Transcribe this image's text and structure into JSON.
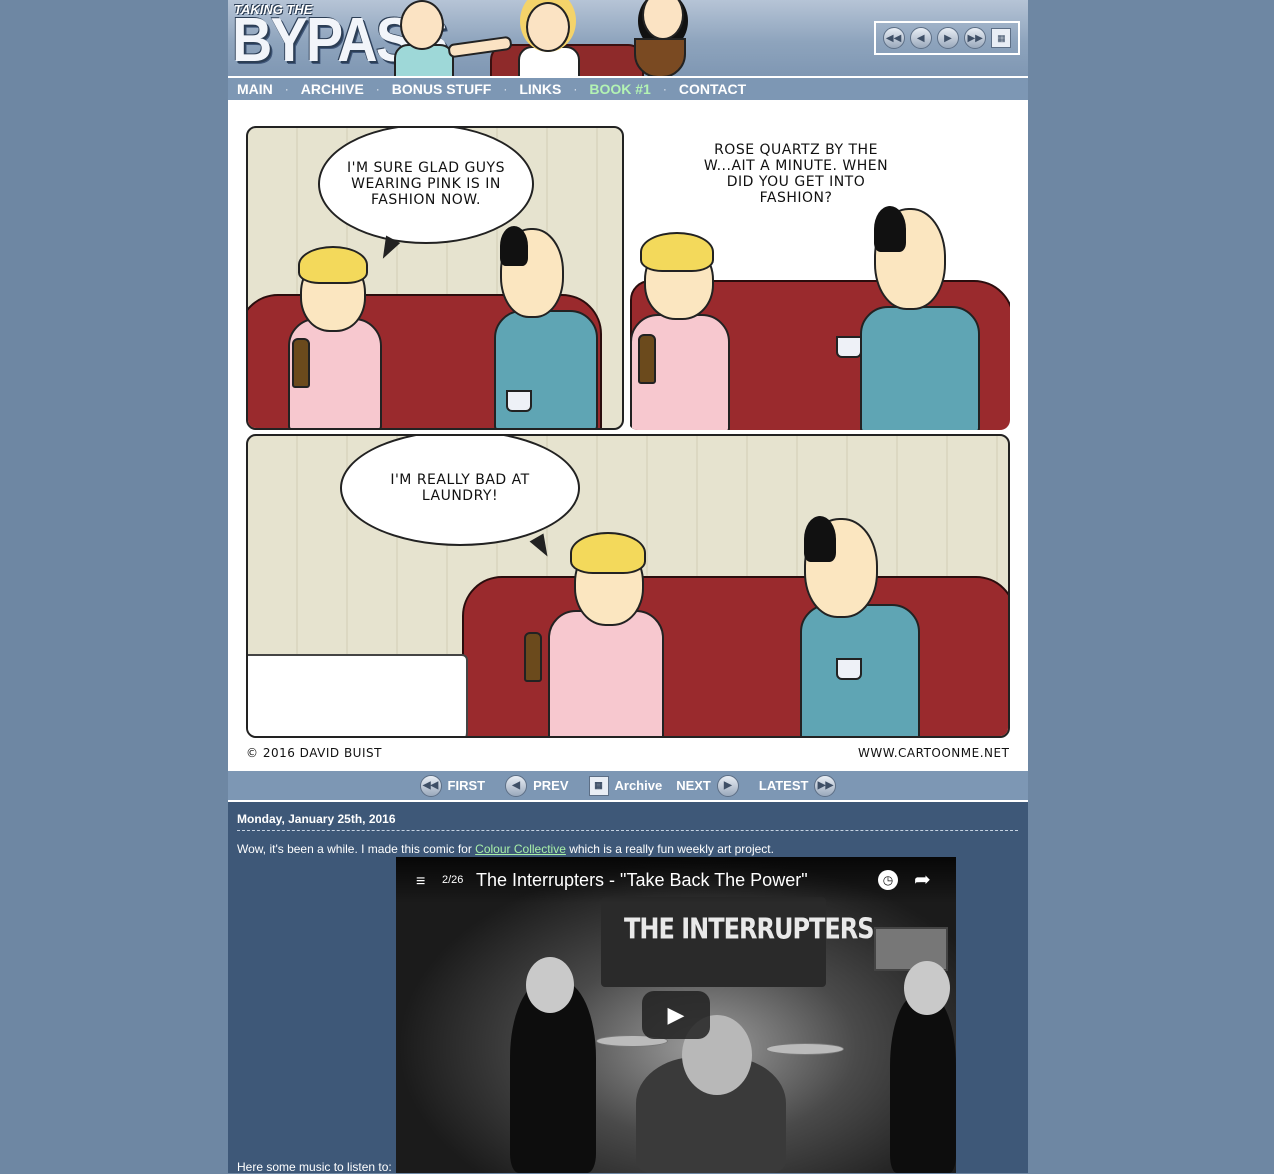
{
  "header": {
    "logo_small": "TAKING THE",
    "logo_big": "BYPASS",
    "nav_buttons": [
      "first-icon",
      "prev-icon",
      "next-icon",
      "last-icon",
      "calendar-icon"
    ]
  },
  "menu": {
    "items": [
      {
        "label": "MAIN"
      },
      {
        "label": "ARCHIVE"
      },
      {
        "label": "BONUS STUFF"
      },
      {
        "label": "LINKS"
      },
      {
        "label": "BOOK #1",
        "active": true
      },
      {
        "label": "CONTACT"
      }
    ],
    "separator": "·",
    "active_color": "#b3f3b3"
  },
  "comic": {
    "panel1_bubble": "I'M SURE GLAD GUYS WEARING PINK IS IN FASHION NOW.",
    "panel2_text": "ROSE QUARTZ BY THE W...AIT A MINUTE. WHEN DID YOU GET INTO FASHION?",
    "panel3_bubble": "I'M REALLY BAD AT LAUNDRY!",
    "copyright": "© 2016 DAVID BUIST",
    "website": "WWW.CARTOONME.NET"
  },
  "comic_nav": {
    "first": "FIRST",
    "prev": "PREV",
    "archive": "Archive",
    "next": "NEXT",
    "latest": "LATEST"
  },
  "post": {
    "date": "Monday, January 25th, 2016",
    "text_before": "Wow, it's been a while. I made this comic for ",
    "link": "Colour Collective",
    "text_after": " which is a really fun weekly art project.",
    "music_label": "Here some music to listen to:"
  },
  "video": {
    "counter": "2/26",
    "title": "The Interrupters - \"Take Back The Power\"",
    "banner": "THE INTERRUPTERS"
  },
  "colors": {
    "background": "#6e87a3",
    "menu_bar": "#7d97b4",
    "blog_bg": "#3e5878",
    "link": "#a8f0a8"
  }
}
